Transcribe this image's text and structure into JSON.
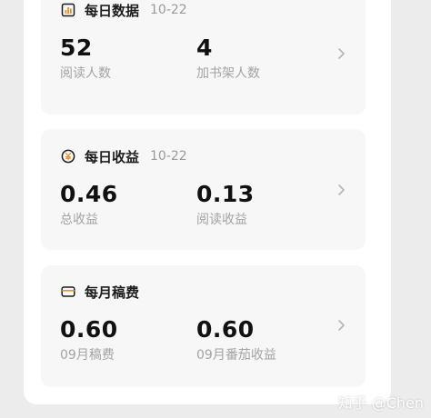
{
  "daily_data": {
    "icon": "bar-chart-icon",
    "title": "每日数据",
    "date": "10-22",
    "metrics": [
      {
        "value": "52",
        "label": "阅读人数"
      },
      {
        "value": "4",
        "label": "加书架人数"
      }
    ]
  },
  "daily_income": {
    "icon": "yen-coin-icon",
    "title": "每日收益",
    "date": "10-22",
    "metrics": [
      {
        "value": "0.46",
        "label": "总收益"
      },
      {
        "value": "0.13",
        "label": "阅读收益"
      }
    ]
  },
  "monthly_fee": {
    "icon": "wallet-card-icon",
    "title": "每月稿费",
    "metrics": [
      {
        "value": "0.60",
        "label": "09月稿费"
      },
      {
        "value": "0.60",
        "label": "09月番茄收益"
      }
    ]
  },
  "watermark": "知乎 @Chen",
  "colors": {
    "accent_orange": "#e8912c",
    "background": "#ececec",
    "card": "#f7f7f7"
  }
}
